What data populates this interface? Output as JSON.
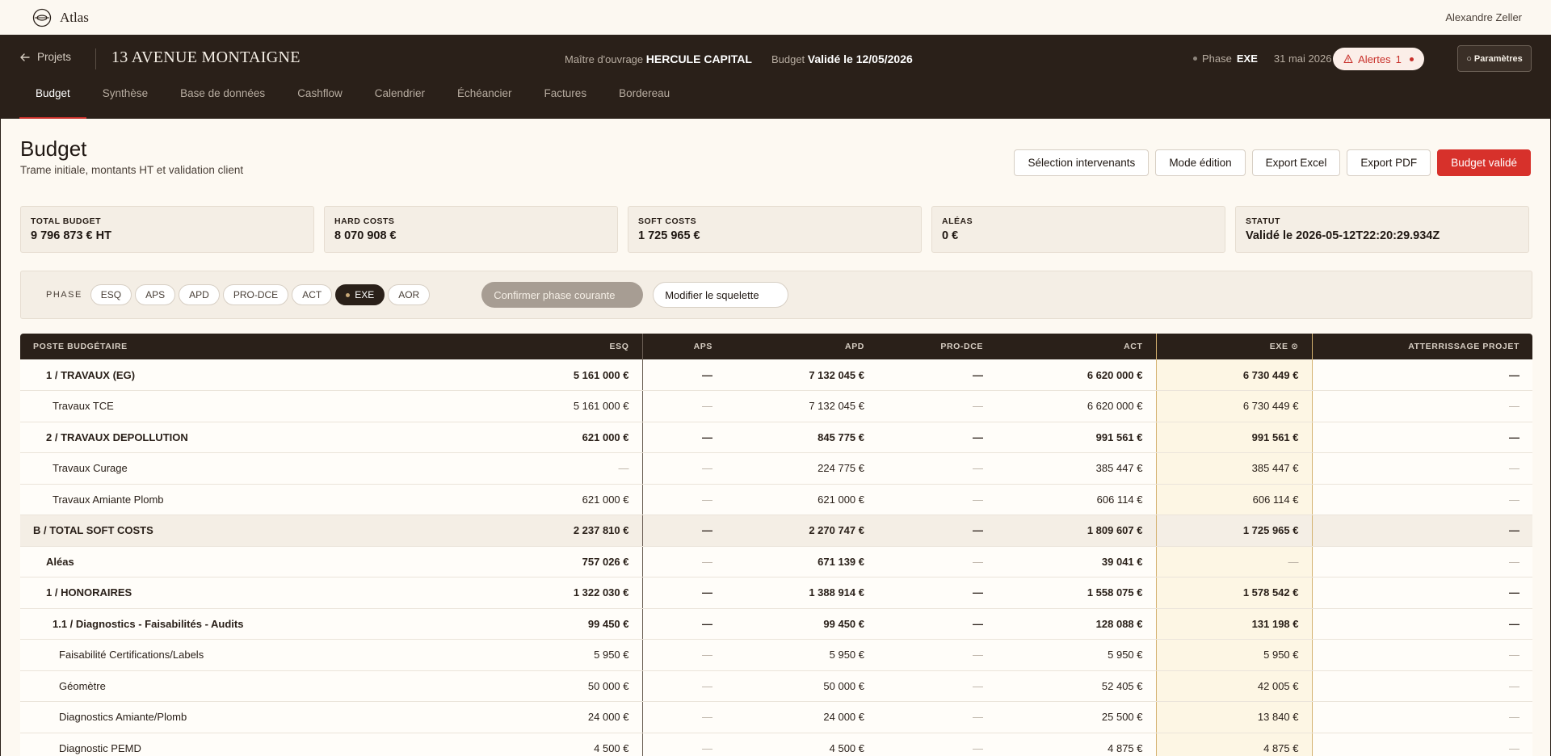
{
  "topbar": {
    "brand": "Atlas",
    "user": "Alexandre Zeller"
  },
  "header": {
    "back_label": "Projets",
    "project_title": "13 AVENUE MONTAIGNE",
    "owner_label": "Maître d'ouvrage",
    "owner_value": "HERCULE CAPITAL",
    "budget_label": "Budget",
    "budget_value": "Validé le 12/05/2026",
    "phase_label": "Phase",
    "phase_value": "EXE",
    "date": "31 mai 2026",
    "alerts_label": "Alertes",
    "alerts_count": "1",
    "settings_label": "Paramètres"
  },
  "tabs": [
    "Budget",
    "Synthèse",
    "Base de données",
    "Cashflow",
    "Calendrier",
    "Échéancier",
    "Factures",
    "Bordereau"
  ],
  "page": {
    "title": "Budget",
    "subtitle": "Trame initiale, montants HT et validation client",
    "actions": [
      "Sélection intervenants",
      "Mode édition",
      "Export Excel",
      "Export PDF",
      "Budget validé"
    ]
  },
  "stats": [
    {
      "label": "TOTAL BUDGET",
      "value": "9 796 873 € HT"
    },
    {
      "label": "HARD COSTS",
      "value": "8 070 908 €"
    },
    {
      "label": "SOFT COSTS",
      "value": "1 725 965 €"
    },
    {
      "label": "ALÉAS",
      "value": "0 €"
    },
    {
      "label": "STATUT",
      "value": "Validé le 2026-05-12T22:20:29.934Z"
    }
  ],
  "phasebar": {
    "label": "PHASE",
    "phases": [
      "ESQ",
      "APS",
      "APD",
      "PRO-DCE",
      "ACT",
      "EXE",
      "AOR"
    ],
    "active": "EXE",
    "confirm_label": "Confirmer phase courante",
    "skeleton_label": "Modifier le squelette"
  },
  "table": {
    "headers": [
      "POSTE BUDGÉTAIRE",
      "ESQ",
      "APS",
      "APD",
      "PRO-DCE",
      "ACT",
      "EXE ⊙",
      "ATTERRISSAGE PROJET"
    ],
    "rows": [
      {
        "type": "group",
        "indent": 1,
        "cells": [
          "1 / TRAVAUX (EG)",
          "5 161 000 €",
          "—",
          "7 132 045 €",
          "—",
          "6 620 000 €",
          "6 730 449 €",
          "—"
        ]
      },
      {
        "type": "item",
        "indent": 2,
        "cells": [
          "Travaux TCE",
          "5 161 000 €",
          "—",
          "7 132 045 €",
          "—",
          "6 620 000 €",
          "6 730 449 €",
          "—"
        ]
      },
      {
        "type": "group",
        "indent": 1,
        "cells": [
          "2 / TRAVAUX DEPOLLUTION",
          "621 000 €",
          "—",
          "845 775 €",
          "—",
          "991 561 €",
          "991 561 €",
          "—"
        ]
      },
      {
        "type": "item",
        "indent": 2,
        "cells": [
          "Travaux Curage",
          "—",
          "—",
          "224 775 €",
          "—",
          "385 447 €",
          "385 447 €",
          "—"
        ]
      },
      {
        "type": "item",
        "indent": 2,
        "cells": [
          "Travaux Amiante Plomb",
          "621 000 €",
          "—",
          "621 000 €",
          "—",
          "606 114 €",
          "606 114 €",
          "—"
        ]
      },
      {
        "type": "section",
        "indent": 0,
        "cells": [
          "B / TOTAL SOFT COSTS",
          "2 237 810 €",
          "—",
          "2 270 747 €",
          "—",
          "1 809 607 €",
          "1 725 965 €",
          "—"
        ]
      },
      {
        "type": "group-light",
        "indent": 1,
        "cells": [
          "Aléas",
          "757 026 €",
          "—",
          "671 139 €",
          "—",
          "39 041 €",
          "—",
          "—"
        ]
      },
      {
        "type": "group",
        "indent": 1,
        "cells": [
          "1 / HONORAIRES",
          "1 322 030 €",
          "—",
          "1 388 914 €",
          "—",
          "1 558 075 €",
          "1 578 542 €",
          "—"
        ]
      },
      {
        "type": "group",
        "indent": 2,
        "cells": [
          "1.1 / Diagnostics - Faisabilités - Audits",
          "99 450 €",
          "—",
          "99 450 €",
          "—",
          "128 088 €",
          "131 198 €",
          "—"
        ]
      },
      {
        "type": "item",
        "indent": 3,
        "cells": [
          "Faisabilité Certifications/Labels",
          "5 950 €",
          "—",
          "5 950 €",
          "—",
          "5 950 €",
          "5 950 €",
          "—"
        ]
      },
      {
        "type": "item",
        "indent": 3,
        "cells": [
          "Géomètre",
          "50 000 €",
          "—",
          "50 000 €",
          "—",
          "52 405 €",
          "42 005 €",
          "—"
        ]
      },
      {
        "type": "item",
        "indent": 3,
        "cells": [
          "Diagnostics Amiante/Plomb",
          "24 000 €",
          "—",
          "24 000 €",
          "—",
          "25 500 €",
          "13 840 €",
          "—"
        ]
      },
      {
        "type": "item",
        "indent": 3,
        "cells": [
          "Diagnostic PEMD",
          "4 500 €",
          "—",
          "4 500 €",
          "—",
          "4 875 €",
          "4 875 €",
          "—"
        ]
      }
    ]
  },
  "colors": {
    "dark": "#2a2019",
    "accent": "#d7312b",
    "cream": "#fdf9f2",
    "gold": "#d4b16f"
  }
}
